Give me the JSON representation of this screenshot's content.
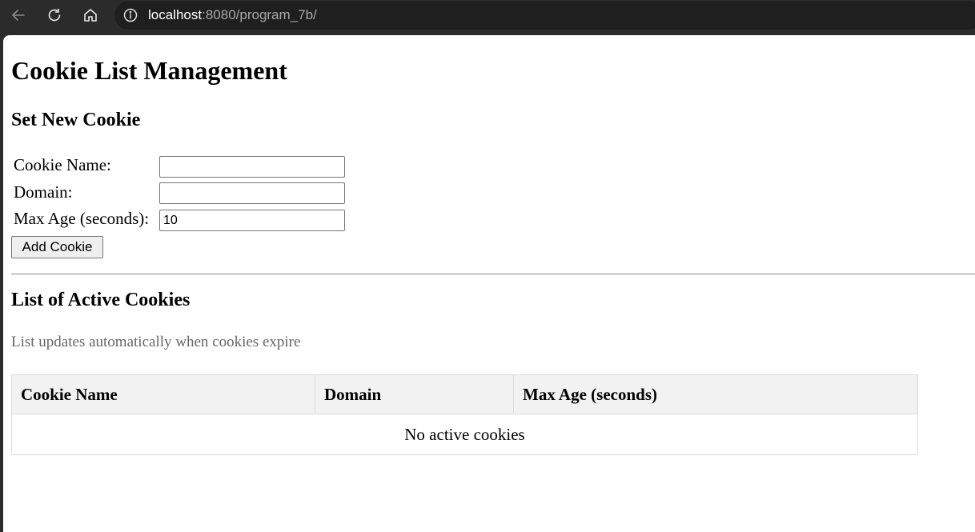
{
  "browser": {
    "url_host": "localhost",
    "url_path": ":8080/program_7b/",
    "icons": {
      "back": "arrow-left-icon",
      "reload": "reload-icon",
      "home": "home-icon",
      "site_info": "info-icon"
    }
  },
  "page": {
    "title": "Cookie List Management",
    "set_cookie_heading": "Set New Cookie",
    "form": {
      "name_label": "Cookie Name:",
      "name_value": "",
      "domain_label": "Domain:",
      "domain_value": "",
      "max_age_label": "Max Age (seconds):",
      "max_age_value": "10",
      "submit_label": "Add Cookie"
    },
    "list_heading": "List of Active Cookies",
    "hint": "List updates automatically when cookies expire",
    "table": {
      "headers": [
        "Cookie Name",
        "Domain",
        "Max Age (seconds)"
      ],
      "empty_message": "No active cookies"
    }
  }
}
